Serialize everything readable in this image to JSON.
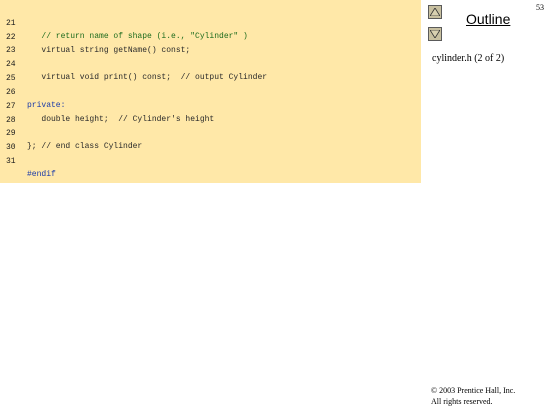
{
  "slide": {
    "page_number": "53",
    "outline_label": "Outline",
    "file_label": "cylinder.h (2 of 2)",
    "copyright_line1": "© 2003 Prentice Hall, Inc.",
    "copyright_line2": "All rights reserved."
  },
  "nav": {
    "prev_icon": "up-triangle-icon",
    "next_icon": "down-triangle-icon"
  },
  "code": {
    "lines": [
      {
        "no": "21",
        "text": "   // return name of shape (i.e., \"Cylinder\" )"
      },
      {
        "no": "22",
        "text": "   virtual string getName() const;"
      },
      {
        "no": "23",
        "text": ""
      },
      {
        "no": "24",
        "text": "   virtual void print() const;  // output Cylinder"
      },
      {
        "no": "25",
        "text": ""
      },
      {
        "no": "26",
        "text": "private:"
      },
      {
        "no": "27",
        "text": "   double height;  // Cylinder's height"
      },
      {
        "no": "28",
        "text": ""
      },
      {
        "no": "29",
        "text": "}; // end class Cylinder"
      },
      {
        "no": "30",
        "text": ""
      },
      {
        "no": "31",
        "text": "#endif"
      }
    ]
  },
  "colors": {
    "code_background": "#ffe8a8",
    "comment": "#1d6b1d",
    "keyword": "#1a3aa8"
  }
}
